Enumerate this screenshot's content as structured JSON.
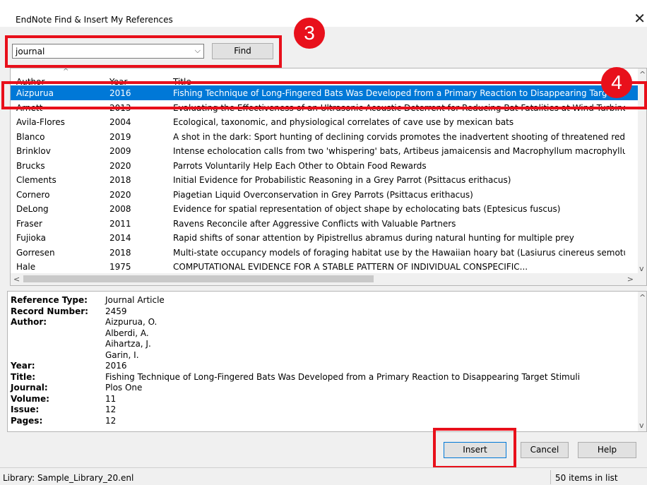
{
  "window": {
    "title": "EndNote Find & Insert My References",
    "close_glyph": "✕"
  },
  "search": {
    "value": "journal",
    "dropdown_glyph": "⌵",
    "find_label": "Find"
  },
  "annotations": {
    "step3": "3",
    "step4": "4",
    "color": "#e8101b"
  },
  "list": {
    "columns": [
      "Author",
      "Year",
      "Title"
    ],
    "sort_glyph": "^",
    "rows": [
      {
        "author": "Aizpurua",
        "year": "2016",
        "title": "Fishing Technique of Long-Fingered Bats Was Developed from a Primary Reaction to Disappearing Target Stimuli"
      },
      {
        "author": "Arnett",
        "year": "2013",
        "title": "Evaluating the Effectiveness of an Ultrasonic Acoustic Deterrent for Reducing Bat Fatalities at Wind Turbines"
      },
      {
        "author": "Avila-Flores",
        "year": "2004",
        "title": "Ecological, taxonomic, and physiological correlates of cave use by mexican bats"
      },
      {
        "author": "Blanco",
        "year": "2019",
        "title": "A shot in the dark: Sport hunting of declining corvids promotes the inadvertent shooting of threatened red-billed"
      },
      {
        "author": "Brinklov",
        "year": "2009",
        "title": "Intense echolocation calls from two 'whispering' bats, Artibeus jamaicensis and Macrophyllum macrophyllum (Phy"
      },
      {
        "author": "Brucks",
        "year": "2020",
        "title": "Parrots Voluntarily Help Each Other to Obtain Food Rewards"
      },
      {
        "author": "Clements",
        "year": "2018",
        "title": "Initial Evidence for Probabilistic Reasoning in a Grey Parrot (Psittacus erithacus)"
      },
      {
        "author": "Cornero",
        "year": "2020",
        "title": "Piagetian Liquid Overconservation in Grey Parrots (Psittacus erithacus)"
      },
      {
        "author": "DeLong",
        "year": "2008",
        "title": "Evidence for spatial representation of object shape by echolocating bats (Eptesicus fuscus)"
      },
      {
        "author": "Fraser",
        "year": "2011",
        "title": "Ravens Reconcile after Aggressive Conflicts with Valuable Partners"
      },
      {
        "author": "Fujioka",
        "year": "2014",
        "title": "Rapid shifts of sonar attention by Pipistrellus abramus during natural hunting for multiple prey"
      },
      {
        "author": "Gorresen",
        "year": "2018",
        "title": "Multi-state occupancy models of foraging habitat use by the Hawaiian hoary bat (Lasiurus cinereus semotus)"
      },
      {
        "author": "Hale",
        "year": "1975",
        "title": "COMPUTATIONAL EVIDENCE FOR A STABLE PATTERN OF INDIVIDUAL CONSPECIFIC..."
      }
    ],
    "scroll_up": "^",
    "scroll_down": "v",
    "scroll_left": "<",
    "scroll_right": ">"
  },
  "detail": {
    "fields": [
      {
        "label": "Reference Type:",
        "value": "Journal Article"
      },
      {
        "label": "Record Number:",
        "value": "2459"
      },
      {
        "label": "Author:",
        "value": "Aizpurua, O."
      },
      {
        "label": "",
        "value": "Alberdi, A."
      },
      {
        "label": "",
        "value": "Aihartza, J."
      },
      {
        "label": "",
        "value": "Garin, I."
      },
      {
        "label": "Year:",
        "value": "2016"
      },
      {
        "label": "Title:",
        "value": "Fishing Technique of Long-Fingered Bats Was Developed from a Primary Reaction to Disappearing Target Stimuli"
      },
      {
        "label": "Journal:",
        "value": "Plos One"
      },
      {
        "label": "Volume:",
        "value": "11"
      },
      {
        "label": "Issue:",
        "value": "12"
      },
      {
        "label": "Pages:",
        "value": "12"
      }
    ]
  },
  "buttons": {
    "insert": "Insert",
    "cancel": "Cancel",
    "help": "Help"
  },
  "status": {
    "library": "Library: Sample_Library_20.enl",
    "count": "50 items in list"
  }
}
